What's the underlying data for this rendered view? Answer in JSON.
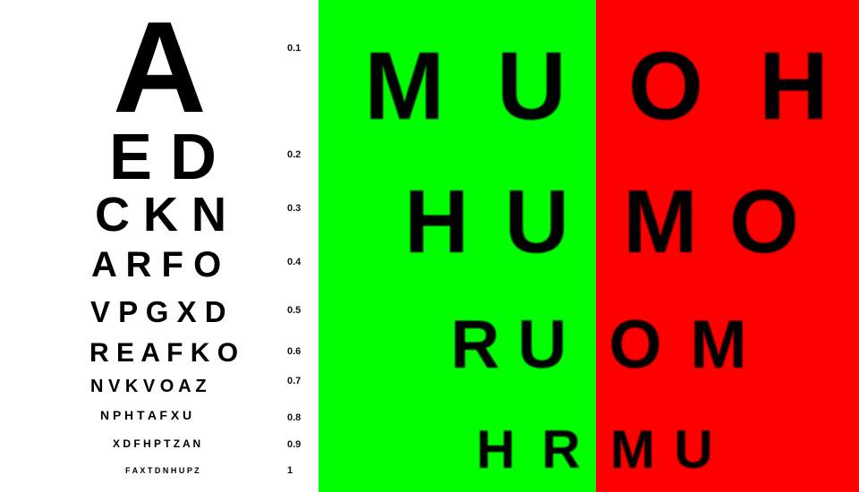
{
  "snellen_chart": {
    "rows": [
      {
        "letters": "A",
        "acuity": "0.1"
      },
      {
        "letters": "E D",
        "acuity": "0.2"
      },
      {
        "letters": "C K N",
        "acuity": "0.3"
      },
      {
        "letters": "A R F O",
        "acuity": "0.4"
      },
      {
        "letters": "V P G X D",
        "acuity": "0.5"
      },
      {
        "letters": "R E A F K O",
        "acuity": "0.6"
      },
      {
        "letters": "N V K V O A Z",
        "acuity": "0.7"
      },
      {
        "letters": "N P H T A F X U",
        "acuity": "0.8"
      },
      {
        "letters": "X D F H P T Z A N",
        "acuity": "0.9"
      },
      {
        "letters": "F A X T D N H U P Z",
        "acuity": "1"
      }
    ]
  },
  "duochrome_chart": {
    "colors": {
      "green": "#00ff00",
      "red": "#ff0000"
    },
    "green_side": [
      "M U",
      "H U",
      "R U",
      "H R"
    ],
    "red_side": [
      "O H",
      "M O",
      "O M",
      "M U"
    ]
  }
}
